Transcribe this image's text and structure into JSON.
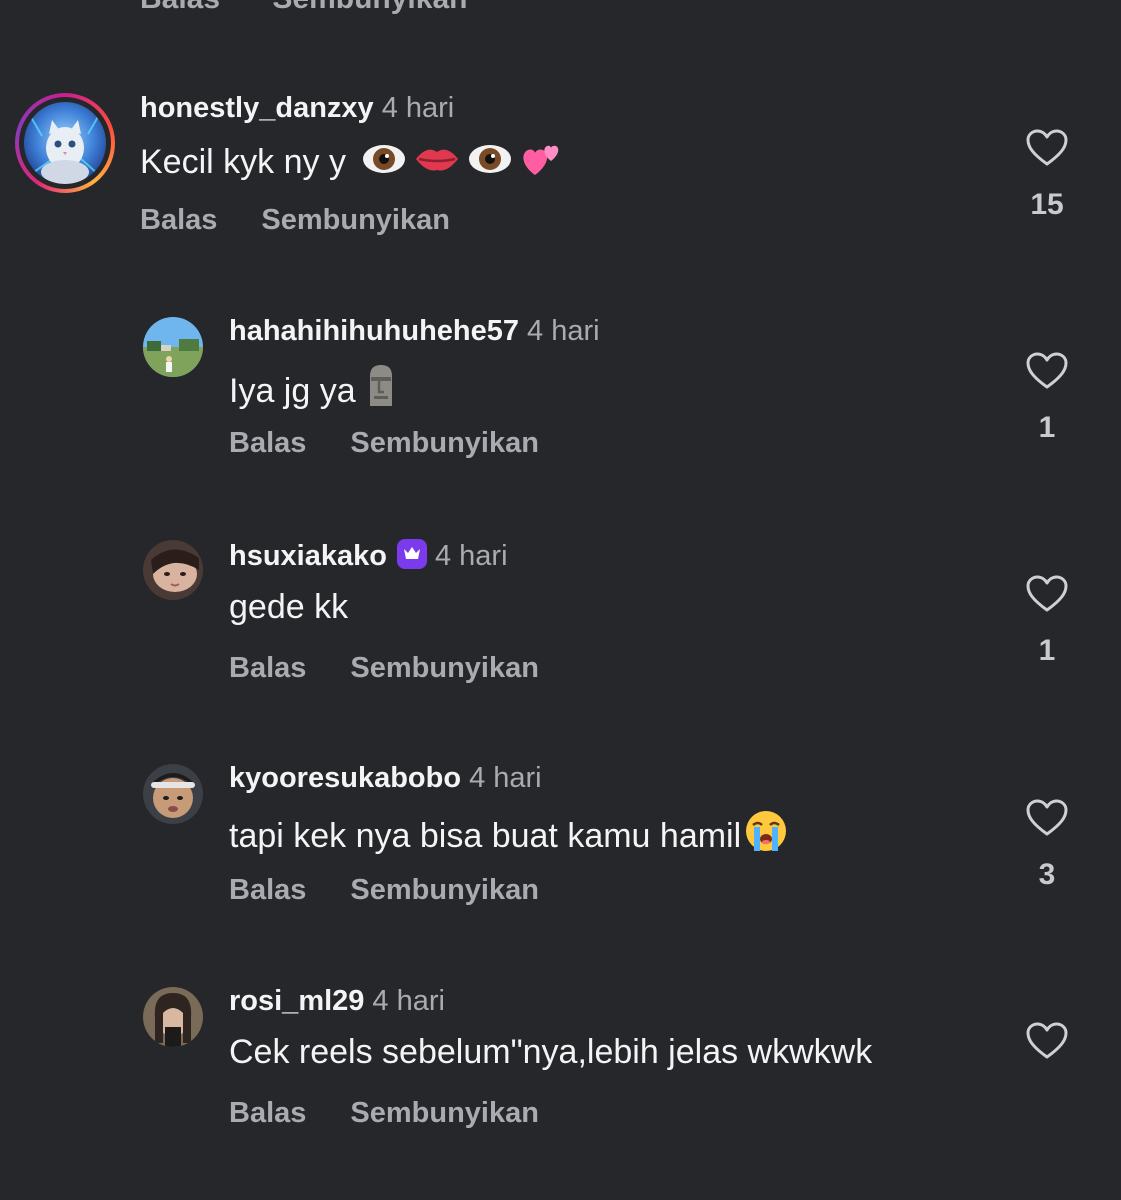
{
  "top_partial": {
    "reply_label": "Balas",
    "hide_label": "Sembunyikan"
  },
  "comments": [
    {
      "username": "honestly_danzxy",
      "time": "4 hari",
      "text": "Kecil kyk ny y",
      "text_emoji": [
        "eye",
        "lips",
        "eye",
        "two-hearts"
      ],
      "reply_label": "Balas",
      "hide_label": "Sembunyikan",
      "likes": "15",
      "has_story_ring": true,
      "verified_badge": false
    },
    {
      "username": "hahahihihuhuhehe57",
      "time": "4 hari",
      "text": "Iya jg ya",
      "text_emoji": [
        "moai"
      ],
      "reply_label": "Balas",
      "hide_label": "Sembunyikan",
      "likes": "1",
      "has_story_ring": false,
      "verified_badge": false
    },
    {
      "username": "hsuxiakako",
      "time": "4 hari",
      "text": "gede kk",
      "text_emoji": [],
      "reply_label": "Balas",
      "hide_label": "Sembunyikan",
      "likes": "1",
      "has_story_ring": false,
      "verified_badge": true
    },
    {
      "username": "kyooresukabobo",
      "time": "4 hari",
      "text": "tapi kek nya bisa buat kamu hamil",
      "text_emoji": [
        "loudly-crying-face"
      ],
      "reply_label": "Balas",
      "hide_label": "Sembunyikan",
      "likes": "3",
      "has_story_ring": false,
      "verified_badge": false
    },
    {
      "username": "rosi_ml29",
      "time": "4 hari",
      "text": "Cek reels sebelum\"nya,lebih jelas wkwkwk",
      "text_emoji": [],
      "reply_label": "Balas",
      "hide_label": "Sembunyikan",
      "likes": "",
      "has_story_ring": false,
      "verified_badge": false
    }
  ],
  "colors": {
    "background": "#26272b",
    "primary_text": "#f4f4f5",
    "secondary_text": "#a9abb1",
    "badge": "#7c3aed"
  }
}
